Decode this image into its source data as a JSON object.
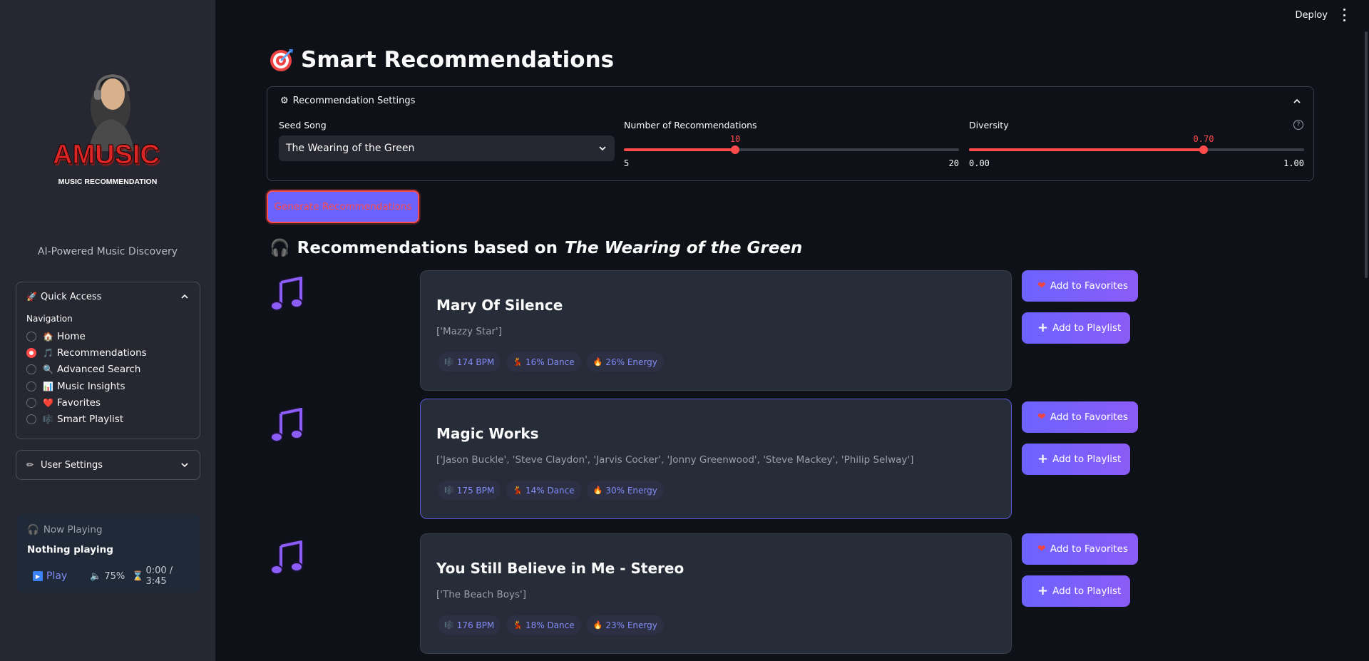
{
  "sidebar": {
    "logo_text": "AMUSIC",
    "logo_subtext": "MUSIC RECOMMENDATION",
    "tagline": "AI-Powered Music Discovery",
    "quick_access": {
      "title": "Quick Access",
      "nav_label": "Navigation",
      "items": [
        {
          "label": "Home",
          "icon": "🏠",
          "selected": false
        },
        {
          "label": "Recommendations",
          "icon": "🎵",
          "selected": true
        },
        {
          "label": "Advanced Search",
          "icon": "🔍",
          "selected": false
        },
        {
          "label": "Music Insights",
          "icon": "📊",
          "selected": false
        },
        {
          "label": "Favorites",
          "icon": "❤️",
          "selected": false
        },
        {
          "label": "Smart Playlist",
          "icon": "🎼",
          "selected": false
        }
      ]
    },
    "user_settings": {
      "title": "User Settings"
    },
    "now_playing": {
      "title": "Now Playing",
      "song": "Nothing playing",
      "play_label": "Play",
      "volume": "75%",
      "time": "0:00 / 3:45"
    }
  },
  "topbar": {
    "deploy_label": "Deploy"
  },
  "main": {
    "title": "Smart Recommendations",
    "settings": {
      "title": "Recommendation Settings",
      "seed_label": "Seed Song",
      "seed_value": "The Wearing of the Green",
      "num_label": "Number of Recommendations",
      "num_value": "10",
      "num_min": "5",
      "num_max": "20",
      "div_label": "Diversity",
      "div_value": "0.70",
      "div_min": "0.00",
      "div_max": "1.00",
      "help": "?"
    },
    "generate_label": "Generate Recommendations",
    "rec_heading_prefix": "Recommendations based on",
    "rec_heading_song": "The Wearing of the Green",
    "recommendations": [
      {
        "title": "Mary Of Silence",
        "artists": "['Mazzy Star']",
        "bpm": "174 BPM",
        "dance": "16% Dance",
        "energy": "26% Energy"
      },
      {
        "title": "Magic Works",
        "artists": "['Jason Buckle', 'Steve Claydon', 'Jarvis Cocker', 'Jonny Greenwood', 'Steve Mackey', 'Philip Selway']",
        "bpm": "175 BPM",
        "dance": "14% Dance",
        "energy": "30% Energy"
      },
      {
        "title": "You Still Believe in Me - Stereo",
        "artists": "['The Beach Boys']",
        "bpm": "176 BPM",
        "dance": "18% Dance",
        "energy": "23% Energy"
      }
    ],
    "fav_label": "Add to Favorites",
    "playlist_label": "Add to Playlist"
  },
  "colors": {
    "accent": "#ff4b4b",
    "primary": "#6c63ff",
    "chip_text": "#818cf8"
  }
}
